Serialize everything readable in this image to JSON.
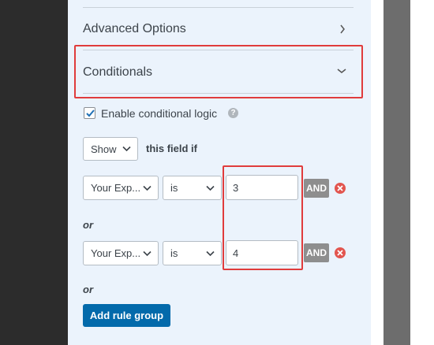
{
  "sections": {
    "advanced_options": "Advanced Options",
    "conditionals": "Conditionals"
  },
  "conditional_logic": {
    "enable_label": "Enable conditional logic",
    "enabled": true,
    "help_glyph": "?",
    "action_value": "Show",
    "this_field_if": "this field if"
  },
  "rule_groups": [
    {
      "field": "Your Exp...",
      "operator": "is",
      "value": "3",
      "and_label": "AND"
    },
    {
      "field": "Your Exp...",
      "operator": "is",
      "value": "4",
      "and_label": "AND"
    }
  ],
  "or_label": "or",
  "add_rule_group_label": "Add rule group",
  "colors": {
    "panel_bg": "#ebf3fc",
    "highlight": "#e03c3c",
    "primary_button": "#036aab",
    "and_button": "#8e8e8e",
    "remove_icon": "#e2554f"
  }
}
